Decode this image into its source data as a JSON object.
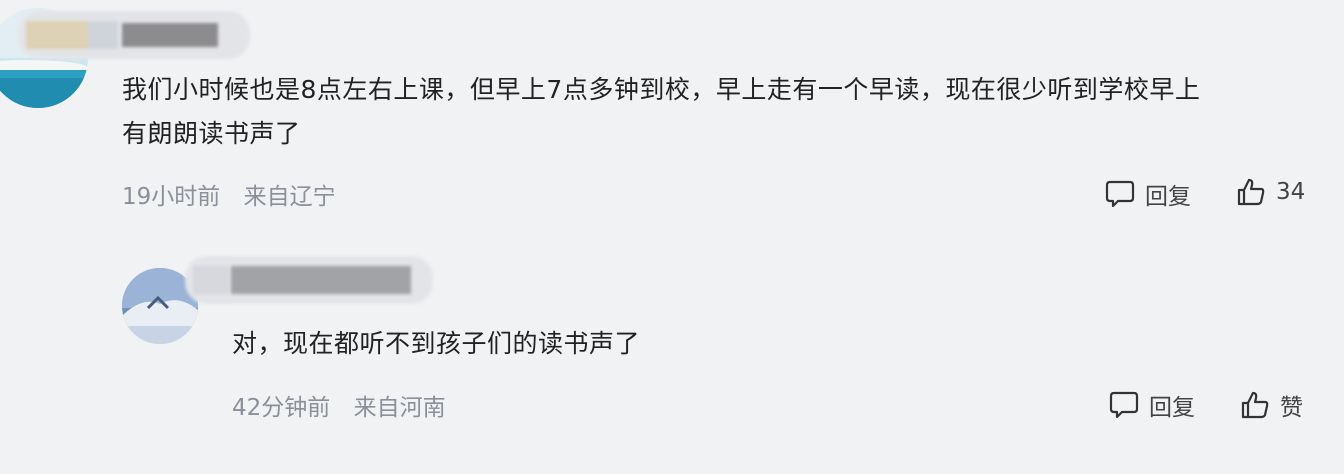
{
  "comments": [
    {
      "text_line1": "我们小时候也是8点左右上课，但早上7点多钟到校，早上走有一个早读，现在很少听到学校早上",
      "text_line2": "有朗朗读书声了",
      "time": "19小时前",
      "location": "来自辽宁",
      "reply_label": "回复",
      "like_label": "34"
    },
    {
      "text_line1": "对，现在都听不到孩子们的读书声了",
      "time": "42分钟前",
      "location": "来自河南",
      "reply_label": "回复",
      "like_label": "赞"
    }
  ],
  "icons": {
    "reply": "comment-bubble-icon",
    "like": "thumbs-up-icon"
  },
  "colors": {
    "background": "#f1f2f4",
    "text": "#222222",
    "meta": "#8a8f99"
  }
}
